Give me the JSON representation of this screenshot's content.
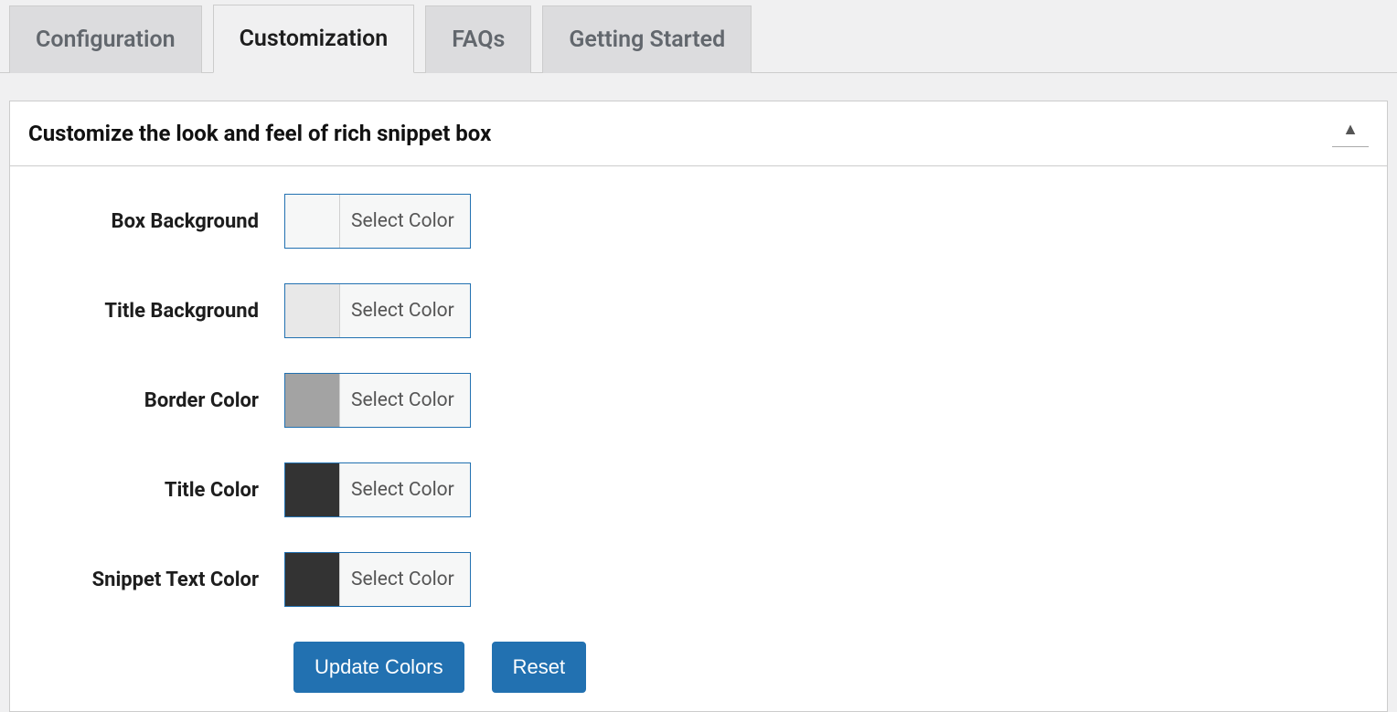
{
  "tabs": {
    "configuration": "Configuration",
    "customization": "Customization",
    "faqs": "FAQs",
    "getting_started": "Getting Started",
    "active": "customization"
  },
  "panel": {
    "title": "Customize the look and feel of rich snippet box"
  },
  "fields": [
    {
      "label": "Box Background",
      "swatch": "#f6f7f7",
      "button_text": "Select Color"
    },
    {
      "label": "Title Background",
      "swatch": "#e8e8e8",
      "button_text": "Select Color"
    },
    {
      "label": "Border Color",
      "swatch": "#a3a3a3",
      "button_text": "Select Color"
    },
    {
      "label": "Title Color",
      "swatch": "#333333",
      "button_text": "Select Color"
    },
    {
      "label": "Snippet Text Color",
      "swatch": "#333333",
      "button_text": "Select Color"
    }
  ],
  "buttons": {
    "update": "Update Colors",
    "reset": "Reset"
  }
}
